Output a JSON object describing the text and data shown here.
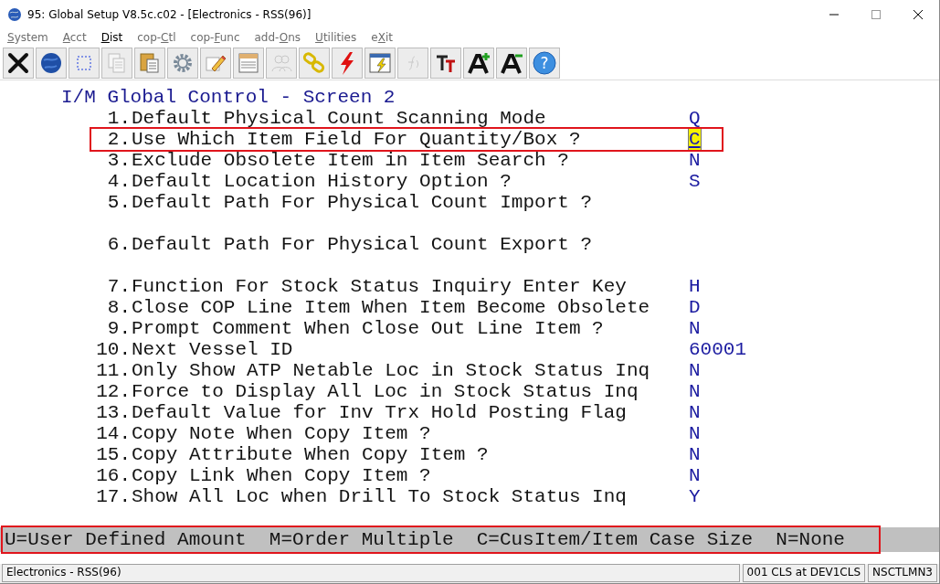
{
  "window": {
    "title": "95: Global Setup V8.5c.c02 - [Electronics - RSS(96)]"
  },
  "menu": [
    {
      "key": "S",
      "post": "ystem",
      "disabled": true
    },
    {
      "key": "A",
      "post": "cct",
      "disabled": true
    },
    {
      "key": "D",
      "post": "ist",
      "disabled": false
    },
    {
      "pre": "cop-",
      "key": "C",
      "post": "tl",
      "disabled": true
    },
    {
      "pre": "cop-",
      "key": "F",
      "post": "unc",
      "disabled": true
    },
    {
      "pre": "add-",
      "key": "O",
      "post": "ns",
      "disabled": true
    },
    {
      "key": "U",
      "post": "tilities",
      "disabled": true
    },
    {
      "pre": "e",
      "key": "X",
      "post": "it",
      "disabled": true
    }
  ],
  "toolbar": [
    {
      "kind": "close",
      "disabled": false
    },
    {
      "kind": "globe",
      "disabled": false
    },
    {
      "kind": "select",
      "disabled": false
    },
    {
      "kind": "copy",
      "disabled": true
    },
    {
      "kind": "paste",
      "disabled": false
    },
    {
      "kind": "gear",
      "disabled": false
    },
    {
      "kind": "pencil",
      "disabled": false
    },
    {
      "kind": "notepad",
      "disabled": false
    },
    {
      "kind": "people",
      "disabled": true
    },
    {
      "kind": "chain",
      "disabled": false
    },
    {
      "kind": "bolt",
      "disabled": false
    },
    {
      "kind": "window-bolt",
      "disabled": false
    },
    {
      "kind": "function",
      "disabled": true
    },
    {
      "kind": "font",
      "disabled": false
    },
    {
      "kind": "font-up",
      "disabled": false
    },
    {
      "kind": "font-down",
      "disabled": false
    },
    {
      "kind": "help",
      "glyph": "?",
      "disabled": false
    }
  ],
  "screen": {
    "title": "I/M Global Control - Screen 2",
    "fields": [
      {
        "number": "1.",
        "label": "Default Physical Count Scanning Mode",
        "value": "Q",
        "selected": false
      },
      {
        "number": "2.",
        "label": "Use Which Item Field For Quantity/Box ?",
        "value": "C",
        "selected": true,
        "highlighted": true
      },
      {
        "number": "3.",
        "label": "Exclude Obsolete Item in Item Search ?",
        "value": "N",
        "selected": false
      },
      {
        "number": "4.",
        "label": "Default Location History Option ?",
        "value": "S",
        "selected": false
      },
      {
        "number": "5.",
        "label": "Default Path For Physical Count Import ?",
        "selected": false,
        "gap_after": true
      },
      {
        "number": "6.",
        "label": "Default Path For Physical Count Export ?",
        "selected": false,
        "gap_after": true
      },
      {
        "number": "7.",
        "label": "Function For Stock Status Inquiry Enter Key",
        "value": "H",
        "selected": false
      },
      {
        "number": "8.",
        "label": "Close COP Line Item When Item Become Obsolete",
        "value": "D",
        "selected": false
      },
      {
        "number": "9.",
        "label": "Prompt Comment When Close Out Line Item ?",
        "value": "N",
        "selected": false
      },
      {
        "number": "10.",
        "label": "Next Vessel ID",
        "value": "60001",
        "selected": false
      },
      {
        "number": "11.",
        "label": "Only Show ATP Netable Loc in Stock Status Inq",
        "value": "N",
        "selected": false
      },
      {
        "number": "12.",
        "label": "Force to Display All Loc in Stock Status Inq",
        "value": "N",
        "selected": false
      },
      {
        "number": "13.",
        "label": "Default Value for Inv Trx Hold Posting Flag",
        "value": "N",
        "selected": false
      },
      {
        "number": "14.",
        "label": "Copy Note When Copy Item ?",
        "value": "N",
        "selected": false
      },
      {
        "number": "15.",
        "label": "Copy Attribute When Copy Item ?",
        "value": "N",
        "selected": false
      },
      {
        "number": "16.",
        "label": "Copy Link When Copy Item ?",
        "value": "N",
        "selected": false
      },
      {
        "number": "17.",
        "label": "Show All Loc when Drill To Stock Status Inq",
        "value": "Y",
        "selected": false
      }
    ]
  },
  "help_line": {
    "text": "U=User Defined Amount  M=Order Multiple  C=CusItem/Item Case Size  N=None",
    "highlighted": true
  },
  "status_bar": {
    "left": "Electronics - RSS(96)",
    "middle": "001 CLS at DEV1CLS",
    "right": "NSCTLMN3"
  }
}
